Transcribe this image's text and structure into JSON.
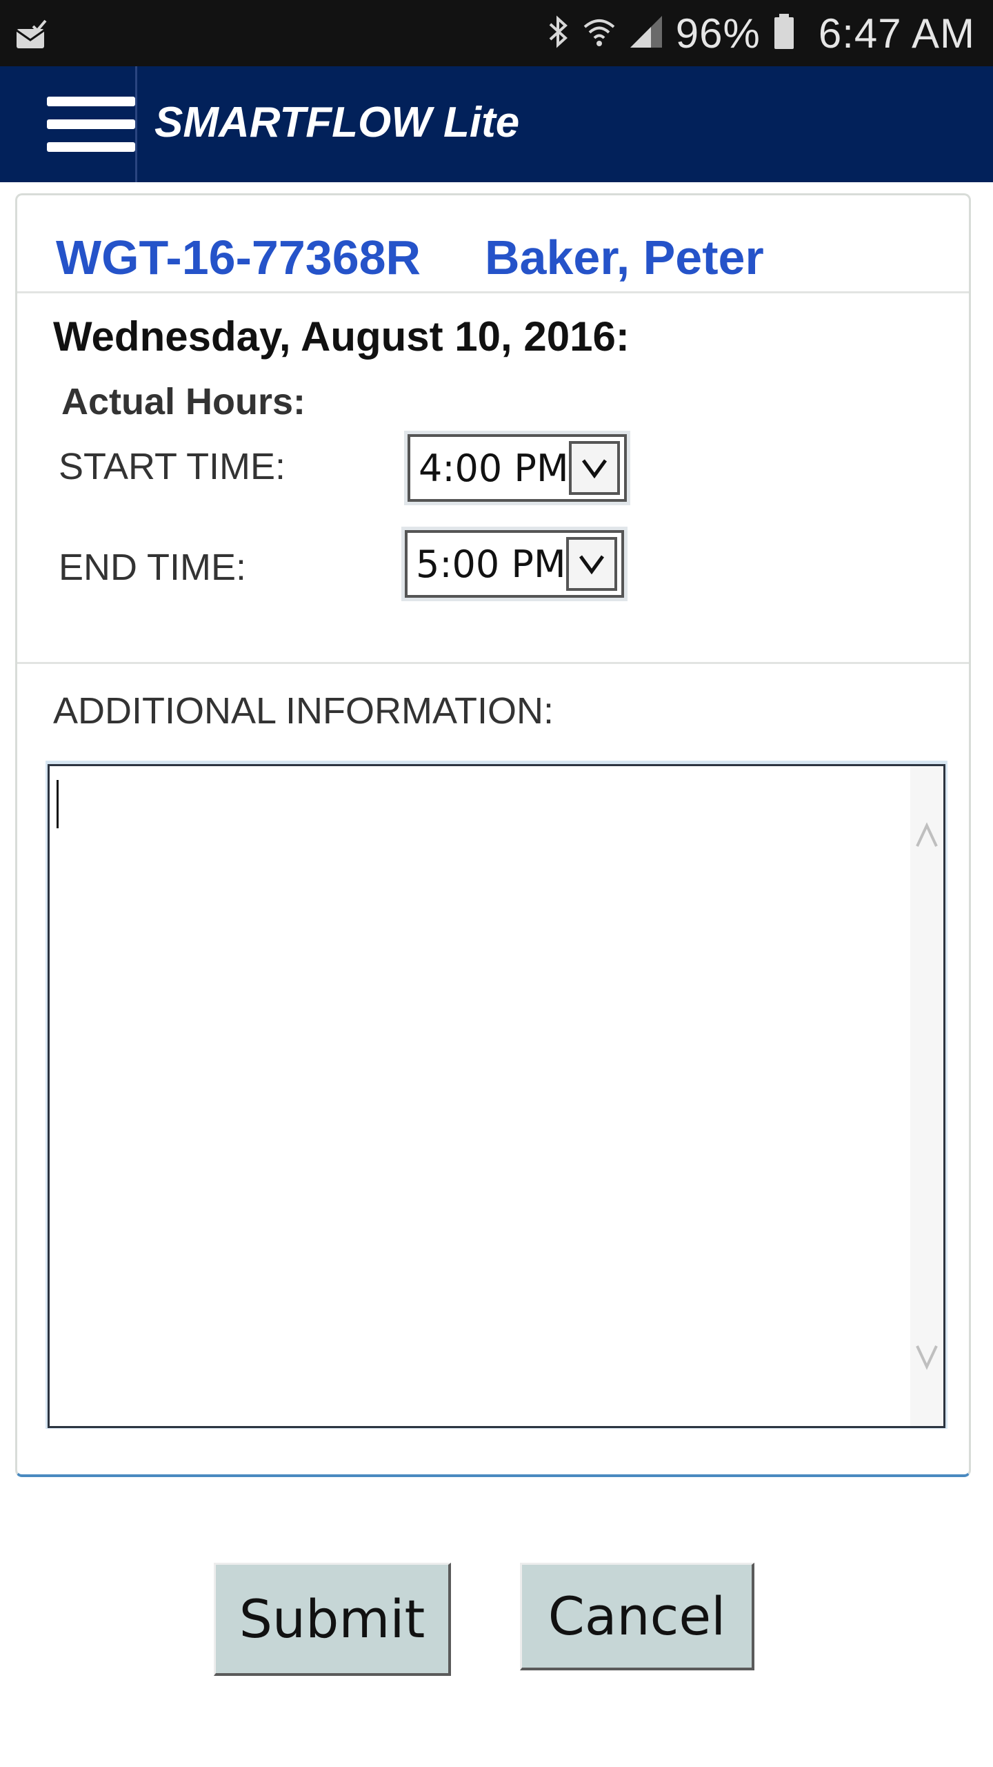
{
  "status_bar": {
    "battery_percent": "96%",
    "time": "6:47 AM",
    "icons": [
      "mail-check-icon",
      "bluetooth-icon",
      "wifi-icon",
      "signal-icon",
      "battery-icon"
    ]
  },
  "app_bar": {
    "menu_icon": "hamburger-menu-icon",
    "title": "SMARTFLOW Lite",
    "background_color": "#02215a"
  },
  "record": {
    "work_order": "WGT-16-77368R",
    "client_name": "Baker, Peter",
    "accent_color": "#2553c9"
  },
  "form": {
    "date_heading": "Wednesday, August 10, 2016:",
    "actual_hours_label": "Actual Hours:",
    "start_time_label": "START TIME:",
    "start_time_value": "4:00 PM",
    "end_time_label": "END TIME:",
    "end_time_value": "5:00 PM",
    "additional_info_label": "ADDITIONAL INFORMATION:",
    "additional_info_value": ""
  },
  "actions": {
    "submit_label": "Submit",
    "cancel_label": "Cancel",
    "button_color": "#c6d6d6"
  }
}
